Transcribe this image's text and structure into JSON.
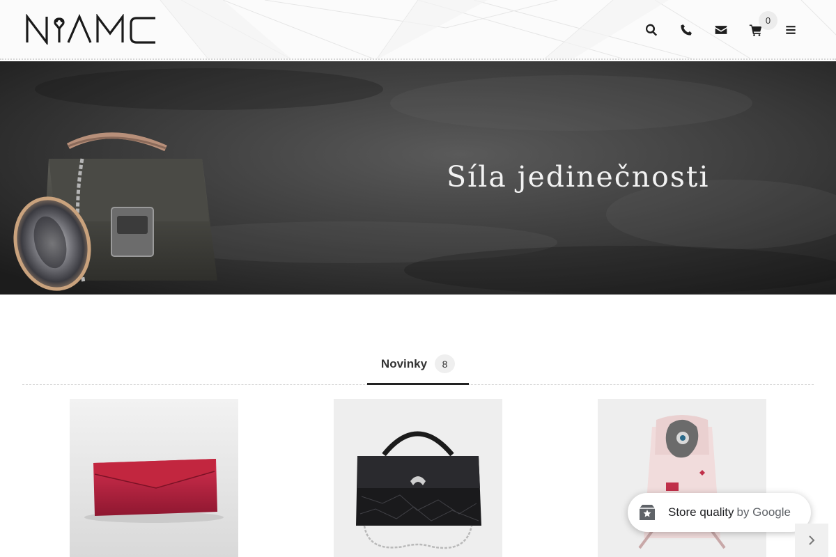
{
  "header": {
    "logo_alt": "NYAMC",
    "cart_count": "0",
    "icons": [
      "search-icon",
      "phone-icon",
      "envelope-icon",
      "cart-icon",
      "menu-icon"
    ]
  },
  "hero": {
    "title": "Síla jedinečnosti"
  },
  "tabs": [
    {
      "label": "Novinky",
      "count": "8"
    }
  ],
  "products": [
    {
      "name": "red-wallet"
    },
    {
      "name": "black-handbag"
    },
    {
      "name": "pink-backpack"
    }
  ],
  "store_quality": {
    "label": "Store quality",
    "by": "by Google"
  },
  "colors": {
    "header_bg": "#fbfbfb",
    "hero_bg": "#2c2c2c",
    "accent": "#222222"
  }
}
